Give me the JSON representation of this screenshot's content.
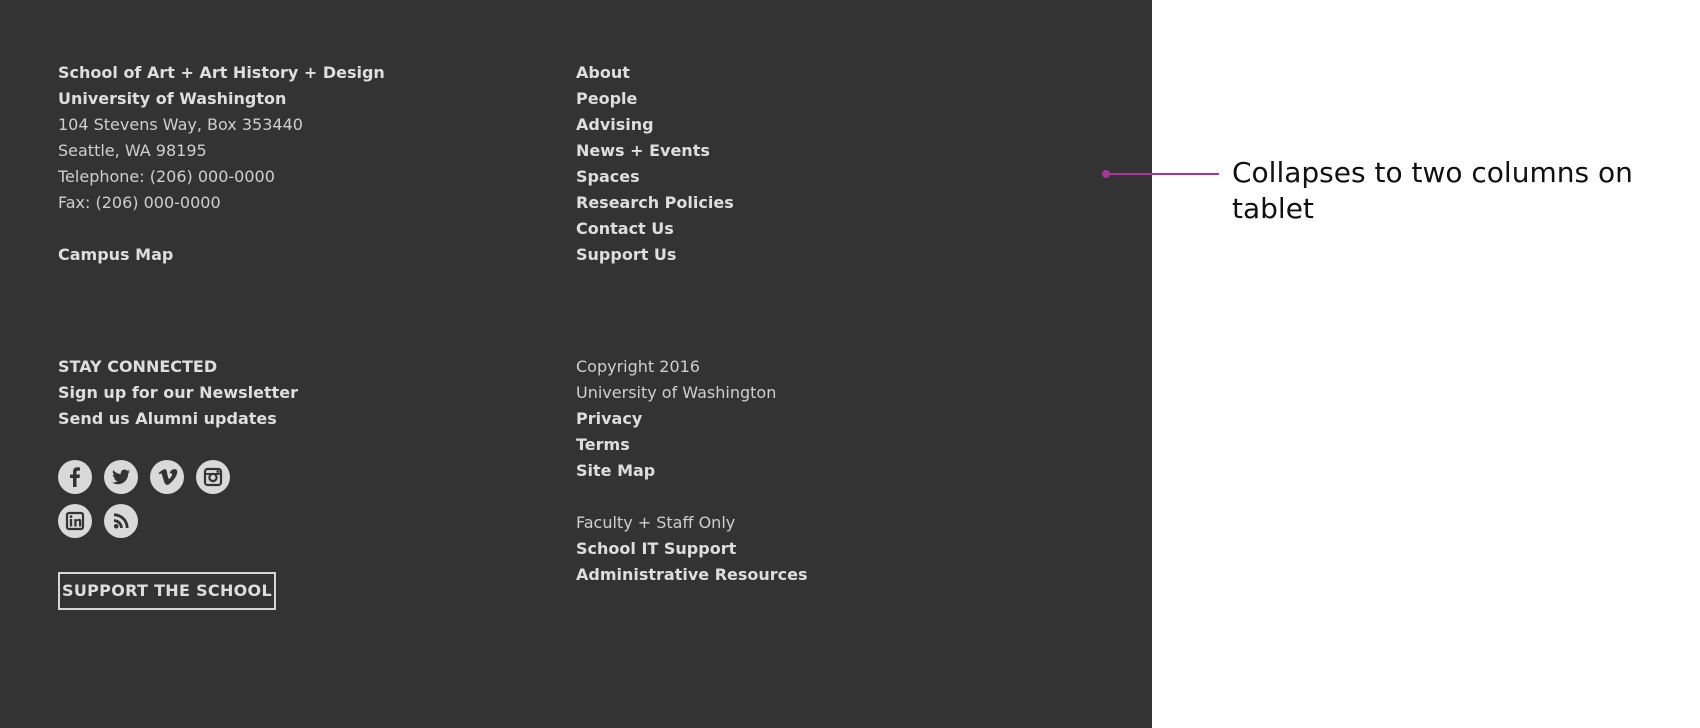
{
  "address": {
    "school": "School of Art + Art History + Design",
    "university": "University of Washington",
    "street": "104 Stevens Way, Box 353440",
    "city": "Seattle, WA 98195",
    "telephone": "Telephone: (206) 000-0000",
    "fax": "Fax: (206) 000-0000",
    "map_link": "Campus Map"
  },
  "nav": {
    "items": [
      "About",
      "People",
      "Advising",
      "News + Events",
      "Spaces",
      "Research Policies",
      "Contact Us",
      "Support Us"
    ]
  },
  "connect": {
    "heading": "STAY CONNECTED",
    "newsletter": "Sign up for our Newsletter",
    "alumni": "Send us Alumni updates",
    "social_icons": [
      "facebook-icon",
      "twitter-icon",
      "vimeo-icon",
      "instagram-icon",
      "linkedin-icon",
      "rss-icon"
    ],
    "support_button": "SUPPORT THE SCHOOL"
  },
  "legal": {
    "copyright": "Copyright 2016",
    "owner": "University of Washington",
    "privacy": "Privacy",
    "terms": "Terms",
    "sitemap": "Site Map"
  },
  "staff": {
    "heading": "Faculty + Staff Only",
    "it_support": "School IT Support",
    "admin": "Administrative Resources"
  },
  "annotation": {
    "text": "Collapses to two columns on tablet",
    "color": "#a3389a"
  },
  "colors": {
    "footer_bg": "#333333",
    "footer_text": "#d6d6d6",
    "page_bg": "#ffffff"
  }
}
